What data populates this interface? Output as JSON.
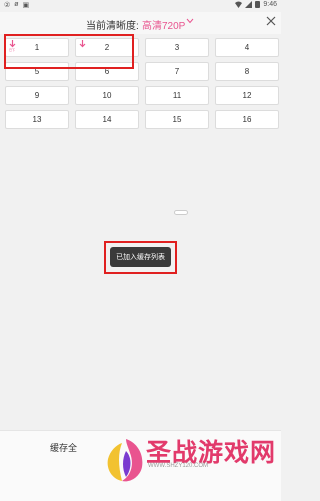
{
  "status_bar": {
    "left_icons": [
      "②",
      "ø",
      "▣"
    ],
    "time": "9:46"
  },
  "header": {
    "label": "当前清晰度:",
    "value": "高清720P"
  },
  "episodes": [
    "1",
    "2",
    "3",
    "4",
    "5",
    "6",
    "7",
    "8",
    "9",
    "10",
    "11",
    "12",
    "13",
    "14",
    "15",
    "16"
  ],
  "download_marker": "已下",
  "toast": "已加入缓存列表",
  "bottom": {
    "cache_all": "缓存全"
  },
  "watermark": {
    "title": "圣战游戏网",
    "url": "WWW.SHZY120.COM"
  },
  "colors": {
    "accent": "#e9548f",
    "annotation": "#e02020",
    "toast_bg": "#3a3a3a"
  }
}
